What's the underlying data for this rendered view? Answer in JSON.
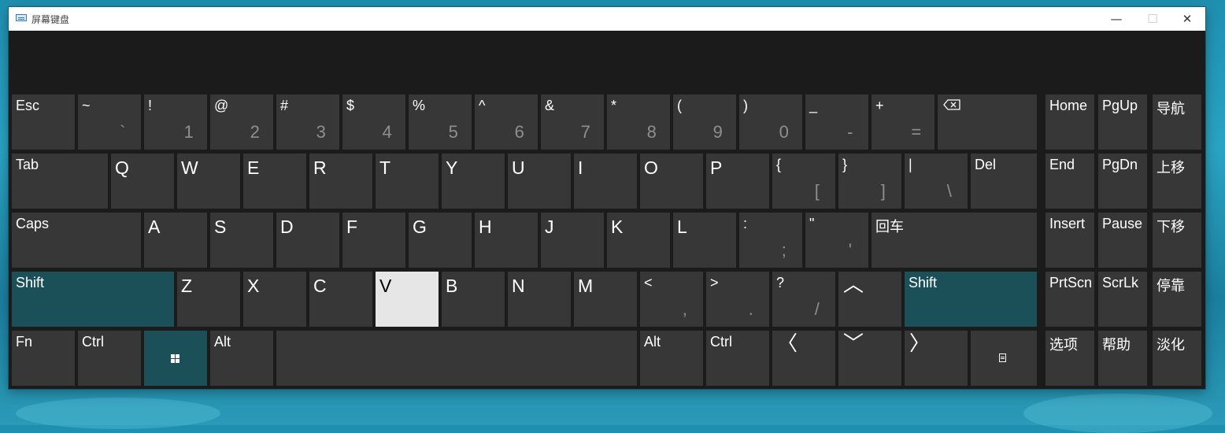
{
  "window": {
    "title": "屏幕键盘"
  },
  "titlebar": {
    "minimize_label": "—",
    "maximize_label": "☐",
    "close_label": "✕"
  },
  "colors": {
    "key_bg": "#373737",
    "accent_key_bg": "#1b5058",
    "pressed_key_bg": "#e6e6e6",
    "window_bg": "#1b1b1b"
  },
  "keyboard": {
    "rows": [
      {
        "name": "number-row",
        "keys": [
          {
            "id": "esc",
            "label": "Esc"
          },
          {
            "id": "tilde",
            "label": "~",
            "sub": "`"
          },
          {
            "id": "1",
            "label": "!",
            "sub": "1"
          },
          {
            "id": "2",
            "label": "@",
            "sub": "2"
          },
          {
            "id": "3",
            "label": "#",
            "sub": "3"
          },
          {
            "id": "4",
            "label": "$",
            "sub": "4"
          },
          {
            "id": "5",
            "label": "%",
            "sub": "5"
          },
          {
            "id": "6",
            "label": "^",
            "sub": "6"
          },
          {
            "id": "7",
            "label": "&",
            "sub": "7"
          },
          {
            "id": "8",
            "label": "*",
            "sub": "8"
          },
          {
            "id": "9",
            "label": "(",
            "sub": "9"
          },
          {
            "id": "0",
            "label": ")",
            "sub": "0"
          },
          {
            "id": "minus",
            "label": "_",
            "sub": "-"
          },
          {
            "id": "equals",
            "label": "+",
            "sub": "="
          },
          {
            "id": "backspace",
            "icon": "backspace-icon"
          },
          {
            "id": "home",
            "label": "Home"
          },
          {
            "id": "pgup",
            "label": "PgUp"
          },
          {
            "id": "navigate",
            "label": "导航"
          }
        ]
      },
      {
        "name": "qwerty-row",
        "keys": [
          {
            "id": "tab",
            "label": "Tab"
          },
          {
            "id": "q",
            "label": "Q",
            "big": true
          },
          {
            "id": "w",
            "label": "W",
            "big": true
          },
          {
            "id": "e",
            "label": "E",
            "big": true
          },
          {
            "id": "r",
            "label": "R",
            "big": true
          },
          {
            "id": "t",
            "label": "T",
            "big": true
          },
          {
            "id": "y",
            "label": "Y",
            "big": true
          },
          {
            "id": "u",
            "label": "U",
            "big": true
          },
          {
            "id": "i",
            "label": "I",
            "big": true
          },
          {
            "id": "o",
            "label": "O",
            "big": true
          },
          {
            "id": "p",
            "label": "P",
            "big": true
          },
          {
            "id": "lbrace",
            "label": "{",
            "sub": "["
          },
          {
            "id": "rbrace",
            "label": "}",
            "sub": "]"
          },
          {
            "id": "pipe",
            "label": "|",
            "sub": "\\"
          },
          {
            "id": "del",
            "label": "Del"
          },
          {
            "id": "end",
            "label": "End"
          },
          {
            "id": "pgdn",
            "label": "PgDn"
          },
          {
            "id": "move-up",
            "label": "上移"
          }
        ]
      },
      {
        "name": "home-row",
        "keys": [
          {
            "id": "caps",
            "label": "Caps"
          },
          {
            "id": "a",
            "label": "A",
            "big": true
          },
          {
            "id": "s",
            "label": "S",
            "big": true
          },
          {
            "id": "d",
            "label": "D",
            "big": true
          },
          {
            "id": "f",
            "label": "F",
            "big": true
          },
          {
            "id": "g",
            "label": "G",
            "big": true
          },
          {
            "id": "h",
            "label": "H",
            "big": true
          },
          {
            "id": "j",
            "label": "J",
            "big": true
          },
          {
            "id": "k",
            "label": "K",
            "big": true
          },
          {
            "id": "l",
            "label": "L",
            "big": true
          },
          {
            "id": "colon",
            "label": ":",
            "sub": ";"
          },
          {
            "id": "quote",
            "label": "\"",
            "sub": "'"
          },
          {
            "id": "enter",
            "label": "回车"
          },
          {
            "id": "insert",
            "label": "Insert"
          },
          {
            "id": "pause",
            "label": "Pause"
          },
          {
            "id": "move-down",
            "label": "下移"
          }
        ]
      },
      {
        "name": "shift-row",
        "keys": [
          {
            "id": "lshift",
            "label": "Shift",
            "accent": true
          },
          {
            "id": "z",
            "label": "Z",
            "big": true
          },
          {
            "id": "x",
            "label": "X",
            "big": true
          },
          {
            "id": "c",
            "label": "C",
            "big": true
          },
          {
            "id": "v",
            "label": "V",
            "big": true,
            "pressed": true
          },
          {
            "id": "b",
            "label": "B",
            "big": true
          },
          {
            "id": "n",
            "label": "N",
            "big": true
          },
          {
            "id": "m",
            "label": "M",
            "big": true
          },
          {
            "id": "lt",
            "label": "<",
            "sub": ","
          },
          {
            "id": "gt",
            "label": ">",
            "sub": "."
          },
          {
            "id": "question",
            "label": "?",
            "sub": "/"
          },
          {
            "id": "up",
            "icon": "arrow-up-icon",
            "glyph": "︿"
          },
          {
            "id": "rshift",
            "label": "Shift",
            "accent": true
          },
          {
            "id": "prtscn",
            "label": "PrtScn"
          },
          {
            "id": "scrlk",
            "label": "ScrLk"
          },
          {
            "id": "dock",
            "label": "停靠"
          }
        ]
      },
      {
        "name": "bottom-row",
        "keys": [
          {
            "id": "fn",
            "label": "Fn"
          },
          {
            "id": "lctrl",
            "label": "Ctrl"
          },
          {
            "id": "win",
            "icon": "windows-logo-icon",
            "accent": true
          },
          {
            "id": "lalt",
            "label": "Alt"
          },
          {
            "id": "space",
            "label": ""
          },
          {
            "id": "ralt",
            "label": "Alt"
          },
          {
            "id": "rctrl",
            "label": "Ctrl"
          },
          {
            "id": "left",
            "icon": "arrow-left-icon",
            "glyph": "〈"
          },
          {
            "id": "down",
            "icon": "arrow-down-icon",
            "glyph": "﹀"
          },
          {
            "id": "right",
            "icon": "arrow-right-icon",
            "glyph": "〉"
          },
          {
            "id": "menu",
            "icon": "context-menu-icon"
          },
          {
            "id": "options",
            "label": "选项"
          },
          {
            "id": "help",
            "label": "帮助"
          },
          {
            "id": "fade",
            "label": "淡化"
          }
        ]
      }
    ]
  }
}
